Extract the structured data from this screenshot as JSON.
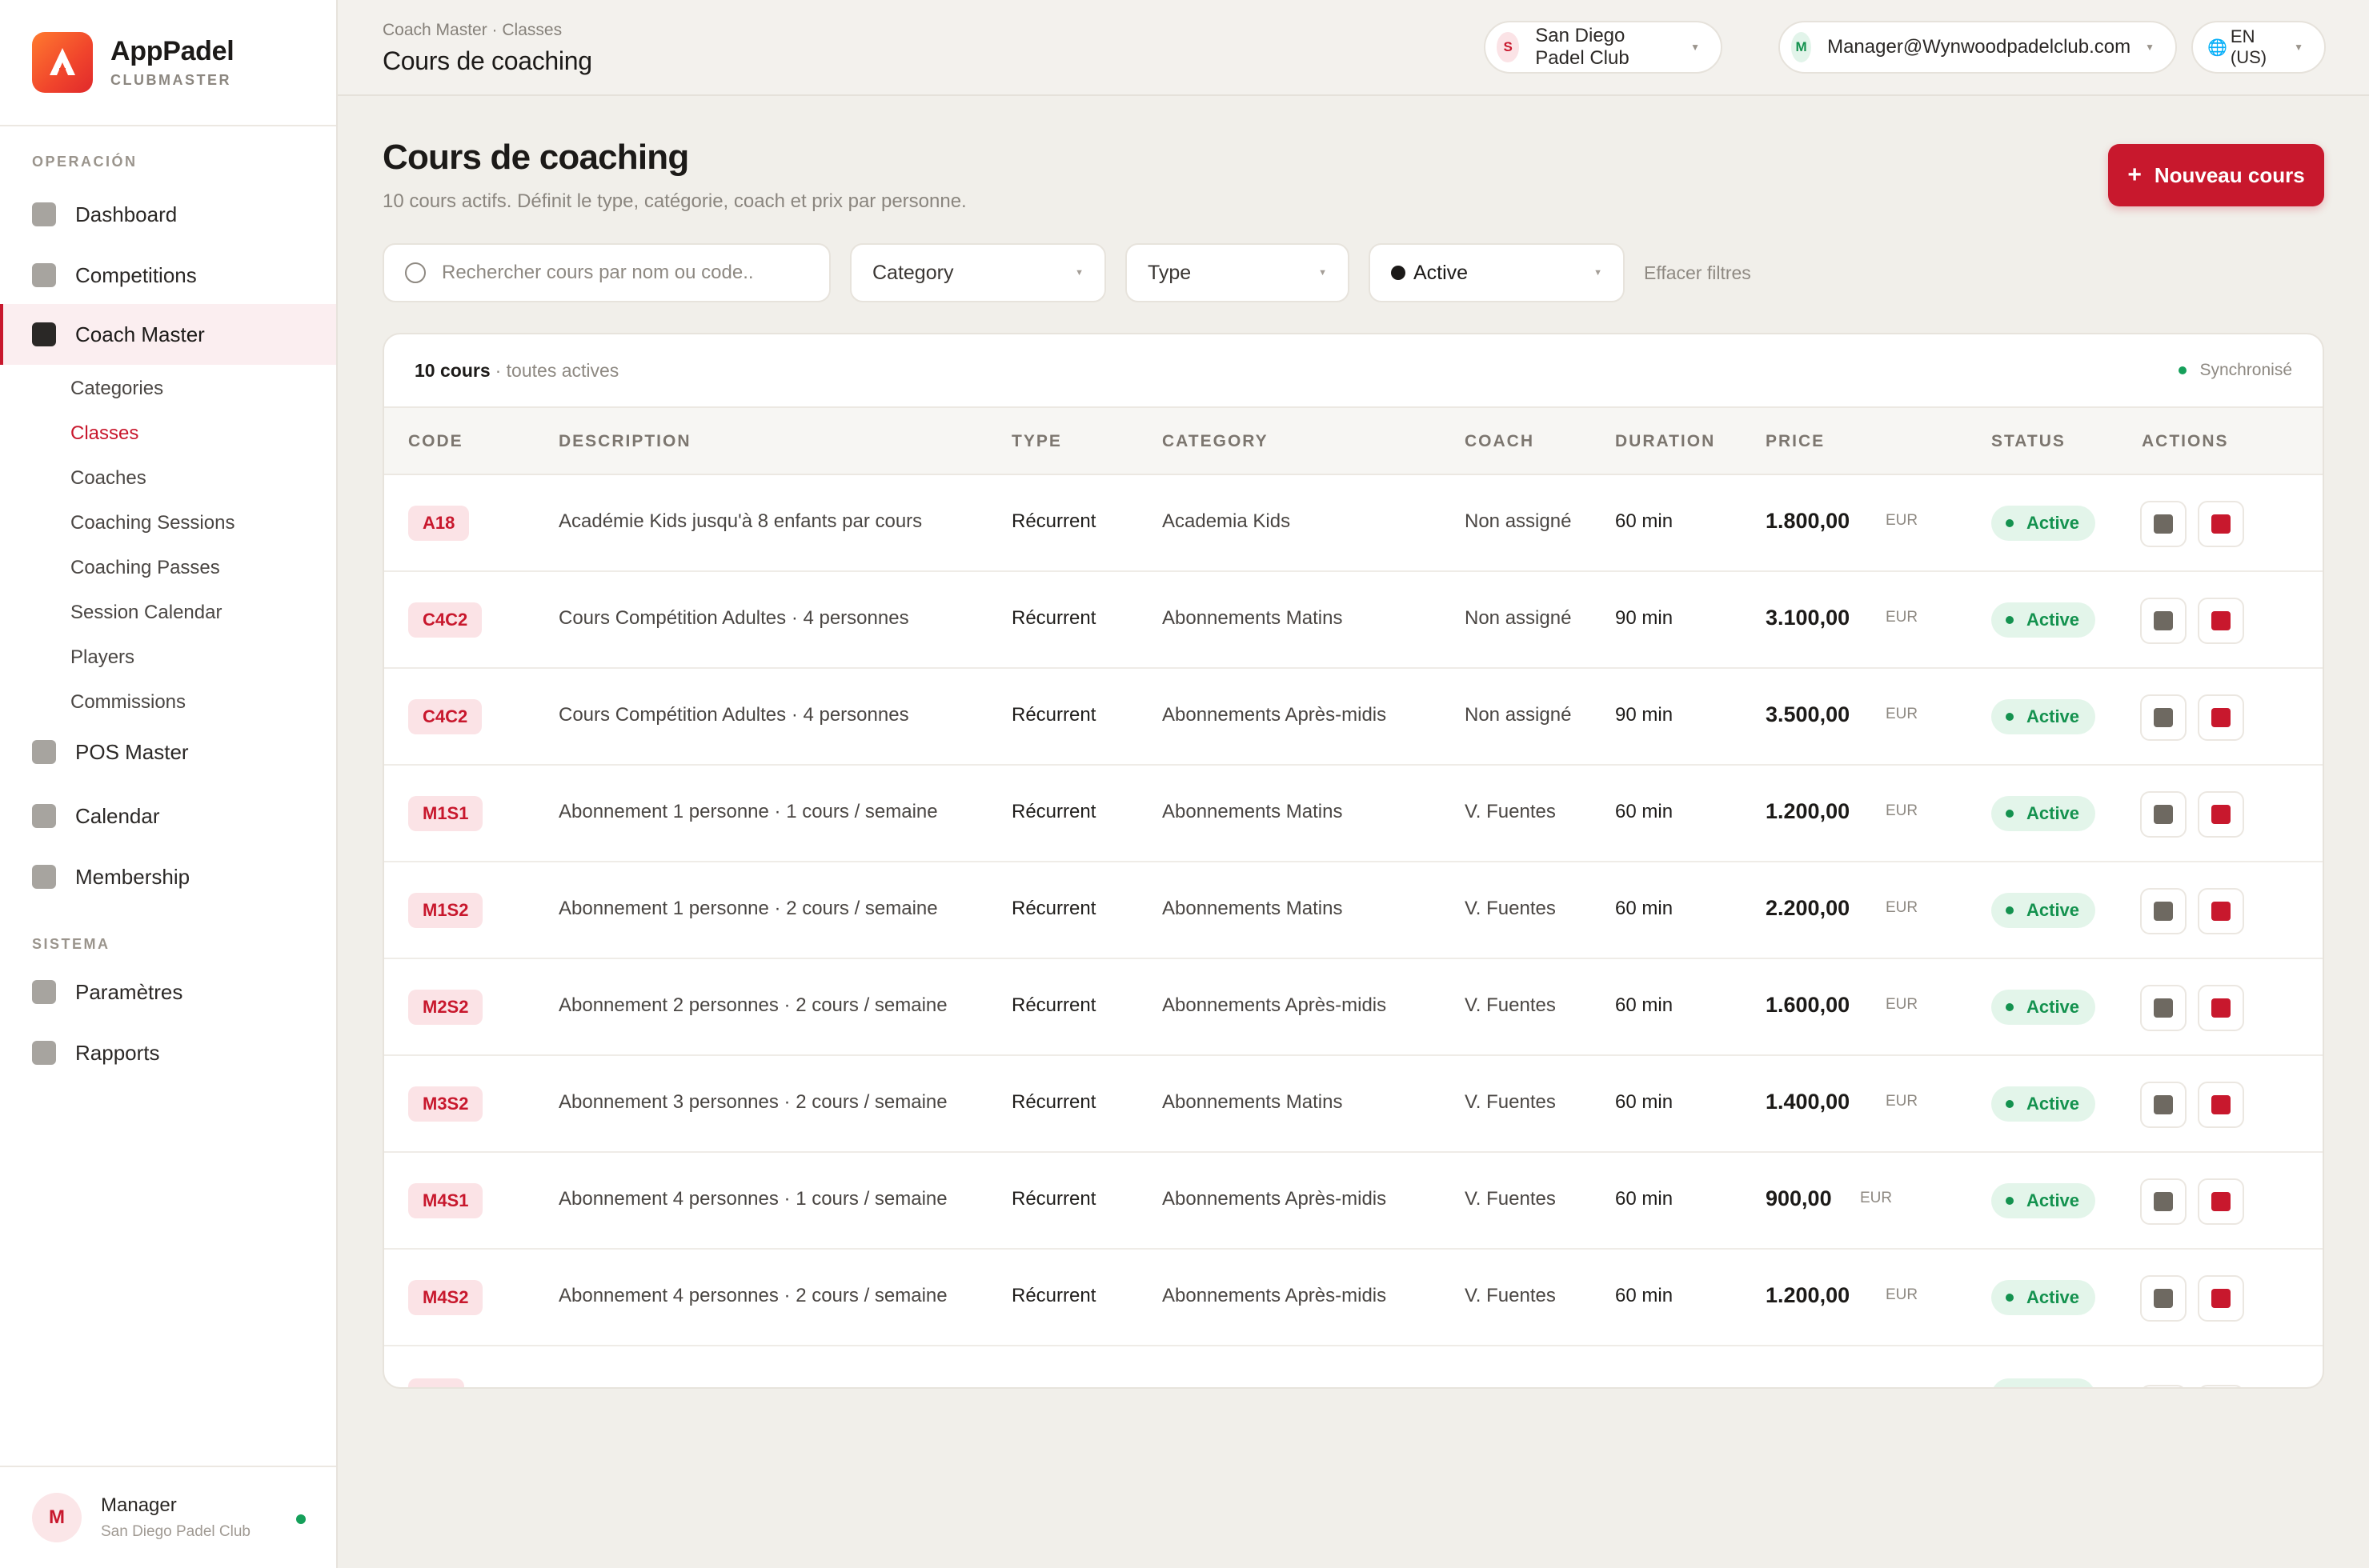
{
  "brand": {
    "name": "AppPadel",
    "subtitle": "CLUBMASTER"
  },
  "sidebar": {
    "section_operation": "OPERACIÓN",
    "section_system": "SISTEMA",
    "items": [
      {
        "label": "Dashboard"
      },
      {
        "label": "Competitions"
      },
      {
        "label": "Coach Master"
      },
      {
        "label": "POS Master"
      },
      {
        "label": "Calendar"
      },
      {
        "label": "Membership"
      },
      {
        "label": "Paramètres"
      },
      {
        "label": "Rapports"
      }
    ],
    "sub_items": [
      {
        "label": "Categories"
      },
      {
        "label": "Classes"
      },
      {
        "label": "Coaches"
      },
      {
        "label": "Coaching Sessions"
      },
      {
        "label": "Coaching Passes"
      },
      {
        "label": "Session Calendar"
      },
      {
        "label": "Players"
      },
      {
        "label": "Commissions"
      }
    ],
    "user": {
      "initial": "M",
      "name": "Manager",
      "club": "San Diego Padel Club"
    }
  },
  "topbar": {
    "breadcrumb": "Coach Master · Classes",
    "title": "Cours de coaching",
    "club": {
      "initial": "S",
      "label": "San Diego Padel Club"
    },
    "account": {
      "initial": "M",
      "label": "Manager@Wynwoodpadelclub.com"
    },
    "language": {
      "icon": "🌐",
      "label": "EN (US)"
    }
  },
  "page": {
    "title": "Cours de coaching",
    "subtitle": "10 cours actifs. Définit le type, catégorie, coach et prix par personne.",
    "new_button": "Nouveau cours"
  },
  "filters": {
    "search_placeholder": "Rechercher cours par nom ou code...",
    "category": "Category",
    "type": "Type",
    "status": "Active",
    "clear": "Effacer filtres"
  },
  "table": {
    "count": "10 cours",
    "count_sub": "· toutes actives",
    "sync": "Synchronisé",
    "columns": [
      "CODE",
      "DESCRIPTION",
      "TYPE",
      "CATEGORY",
      "COACH",
      "DURATION",
      "PRICE",
      "STATUS",
      "ACTIONS"
    ],
    "rows": [
      {
        "code": "A18",
        "description": "Académie Kids jusqu'à 8 enfants par cours",
        "type": "Récurrent",
        "category": "Academia Kids",
        "coach": "Non assigné",
        "duration": "60 min",
        "price": "1.800,00",
        "currency": "EUR",
        "status": "Active"
      },
      {
        "code": "C4C2",
        "description": "Cours Compétition Adultes · 4 personnes",
        "type": "Récurrent",
        "category": "Abonnements Matins",
        "coach": "Non assigné",
        "duration": "90 min",
        "price": "3.100,00",
        "currency": "EUR",
        "status": "Active"
      },
      {
        "code": "C4C2",
        "description": "Cours Compétition Adultes · 4 personnes",
        "type": "Récurrent",
        "category": "Abonnements Après-midis",
        "coach": "Non assigné",
        "duration": "90 min",
        "price": "3.500,00",
        "currency": "EUR",
        "status": "Active"
      },
      {
        "code": "M1S1",
        "description": "Abonnement 1 personne · 1 cours / semaine",
        "type": "Récurrent",
        "category": "Abonnements Matins",
        "coach": "V. Fuentes",
        "duration": "60 min",
        "price": "1.200,00",
        "currency": "EUR",
        "status": "Active"
      },
      {
        "code": "M1S2",
        "description": "Abonnement 1 personne · 2 cours / semaine",
        "type": "Récurrent",
        "category": "Abonnements Matins",
        "coach": "V. Fuentes",
        "duration": "60 min",
        "price": "2.200,00",
        "currency": "EUR",
        "status": "Active"
      },
      {
        "code": "M2S2",
        "description": "Abonnement 2 personnes · 2 cours / semaine",
        "type": "Récurrent",
        "category": "Abonnements Après-midis",
        "coach": "V. Fuentes",
        "duration": "60 min",
        "price": "1.600,00",
        "currency": "EUR",
        "status": "Active"
      },
      {
        "code": "M3S2",
        "description": "Abonnement 3 personnes · 2 cours / semaine",
        "type": "Récurrent",
        "category": "Abonnements Matins",
        "coach": "V. Fuentes",
        "duration": "60 min",
        "price": "1.400,00",
        "currency": "EUR",
        "status": "Active"
      },
      {
        "code": "M4S1",
        "description": "Abonnement 4 personnes · 1 cours / semaine",
        "type": "Récurrent",
        "category": "Abonnements Après-midis",
        "coach": "V. Fuentes",
        "duration": "60 min",
        "price": "900,00",
        "currency": "EUR",
        "status": "Active"
      },
      {
        "code": "M4S2",
        "description": "Abonnement 4 personnes · 2 cours / semaine",
        "type": "Récurrent",
        "category": "Abonnements Après-midis",
        "coach": "V. Fuentes",
        "duration": "60 min",
        "price": "1.200,00",
        "currency": "EUR",
        "status": "Active"
      }
    ]
  },
  "colors": {
    "accent": "#c8182d",
    "success": "#14924f",
    "background": "#f1efea"
  }
}
